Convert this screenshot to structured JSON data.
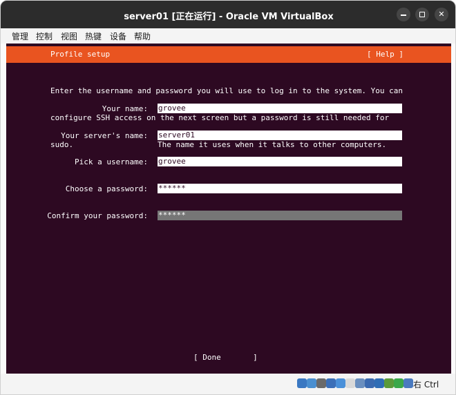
{
  "window": {
    "title": "server01 [正在运行] - Oracle VM VirtualBox"
  },
  "menubar": {
    "items": [
      "管理",
      "控制",
      "视图",
      "热键",
      "设备",
      "帮助"
    ]
  },
  "installer": {
    "header_title": "Profile setup",
    "help_label": "[ Help ]",
    "intro_lines": [
      "Enter the username and password you will use to log in to the system. You can",
      "configure SSH access on the next screen but a password is still needed for",
      "sudo."
    ],
    "fields": {
      "your_name": {
        "label": "Your name:",
        "value": "grovee"
      },
      "server_name": {
        "label": "Your server's name:",
        "value": "server01",
        "hint": "The name it uses when it talks to other computers."
      },
      "username": {
        "label": "Pick a username:",
        "value": "grovee"
      },
      "password": {
        "label": "Choose a password:",
        "value": "******"
      },
      "confirm_password": {
        "label": "Confirm your password:",
        "value": "******"
      }
    },
    "done_label": "[ Done       ]"
  },
  "statusbar": {
    "host_key": "右 Ctrl",
    "icons": [
      "hard-disk-icon",
      "optical-drive-icon",
      "audio-icon",
      "network-icon",
      "usb-icon",
      "shared-folders-icon",
      "display-icon",
      "video-capture-icon",
      "recording-icon",
      "cpu-icon",
      "mouse-integration-icon",
      "keyboard-icon"
    ],
    "icon_colors": [
      "#3a78c2",
      "#4a8fd0",
      "#6a6a6a",
      "#3b6fb8",
      "#4a90d9",
      "#d9d9d9",
      "#6a8fbf",
      "#3a6ab0",
      "#2f6db5",
      "#5a9a3a",
      "#3aa84a",
      "#4a7abf"
    ]
  }
}
